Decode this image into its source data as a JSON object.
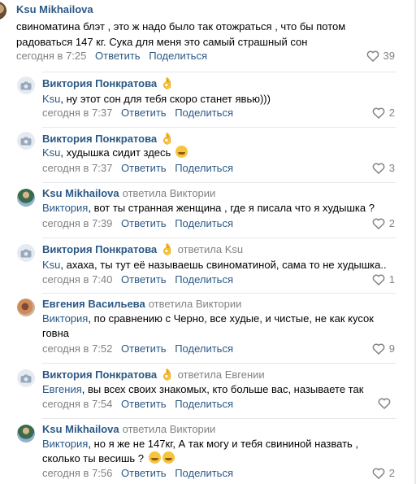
{
  "top_comment": {
    "author": "Ksu Mikhailova",
    "text": "свиноматина блэт , это ж надо было так отожраться , что бы потом радоваться 147 кг. Сука для меня это самый страшный сон",
    "date": "сегодня в 7:25",
    "reply_label": "Ответить",
    "share_label": "Поделиться",
    "likes": "39"
  },
  "replies": [
    {
      "author": "Виктория Понкратова",
      "hand": "👌",
      "replied_to": "",
      "addressee": "Ksu",
      "text": ", ну этот сон для тебя скоро станет явью)))",
      "date": "сегодня в 7:37",
      "reply_label": "Ответить",
      "share_label": "Поделиться",
      "likes": "2",
      "avatar": "camera-icon"
    },
    {
      "author": "Виктория Понкратова",
      "hand": "👌",
      "replied_to": "",
      "addressee": "Ksu",
      "text": ", худышка сидит здесь",
      "date": "сегодня в 7:37",
      "reply_label": "Ответить",
      "share_label": "Поделиться",
      "likes": "3",
      "avatar": "camera-icon"
    },
    {
      "author": "Ksu Mikhailova",
      "hand": "",
      "replied_to": "ответила Виктории",
      "addressee": "Виктория",
      "text": ", вот ты странная женщина , где я писала что я худышка ?",
      "date": "сегодня в 7:39",
      "reply_label": "Ответить",
      "share_label": "Поделиться",
      "likes": "2",
      "avatar": "photo"
    },
    {
      "author": "Виктория Понкратова",
      "hand": "👌",
      "replied_to": "ответила Ksu",
      "addressee": "Ksu",
      "text": ", ахаха, ты тут её называешь свиноматиной, сама то не худышка..",
      "date": "сегодня в 7:40",
      "reply_label": "Ответить",
      "share_label": "Поделиться",
      "likes": "1",
      "avatar": "camera-icon"
    },
    {
      "author": "Евгения Васильева",
      "hand": "",
      "replied_to": "ответила Виктории",
      "addressee": "Виктория",
      "text": ", по сравнению с Черно, все худые, и чистые, не как кусок говна",
      "date": "сегодня в 7:52",
      "reply_label": "Ответить",
      "share_label": "Поделиться",
      "likes": "9",
      "avatar": "photo"
    },
    {
      "author": "Виктория Понкратова",
      "hand": "👌",
      "replied_to": "ответила Евгении",
      "addressee": "Евгения",
      "text": ", вы всех своих знакомых, кто больше вас, называете так",
      "date": "сегодня в 7:54",
      "reply_label": "Ответить",
      "share_label": "Поделиться",
      "likes": "",
      "avatar": "camera-icon"
    },
    {
      "author": "Ksu Mikhailova",
      "hand": "",
      "replied_to": "ответила Виктории",
      "addressee": "Виктория",
      "text": ", но я же не 147кг, А так могу и тебя свининой назвать , сколько ты весишь ?",
      "date": "сегодня в 7:56",
      "reply_label": "Ответить",
      "share_label": "Поделиться",
      "likes": "2",
      "avatar": "photo"
    }
  ],
  "colors": {
    "link": "#2a5885",
    "muted": "#828282",
    "divider": "#e7e8ec",
    "camera_bg": "#e5ebf1"
  }
}
